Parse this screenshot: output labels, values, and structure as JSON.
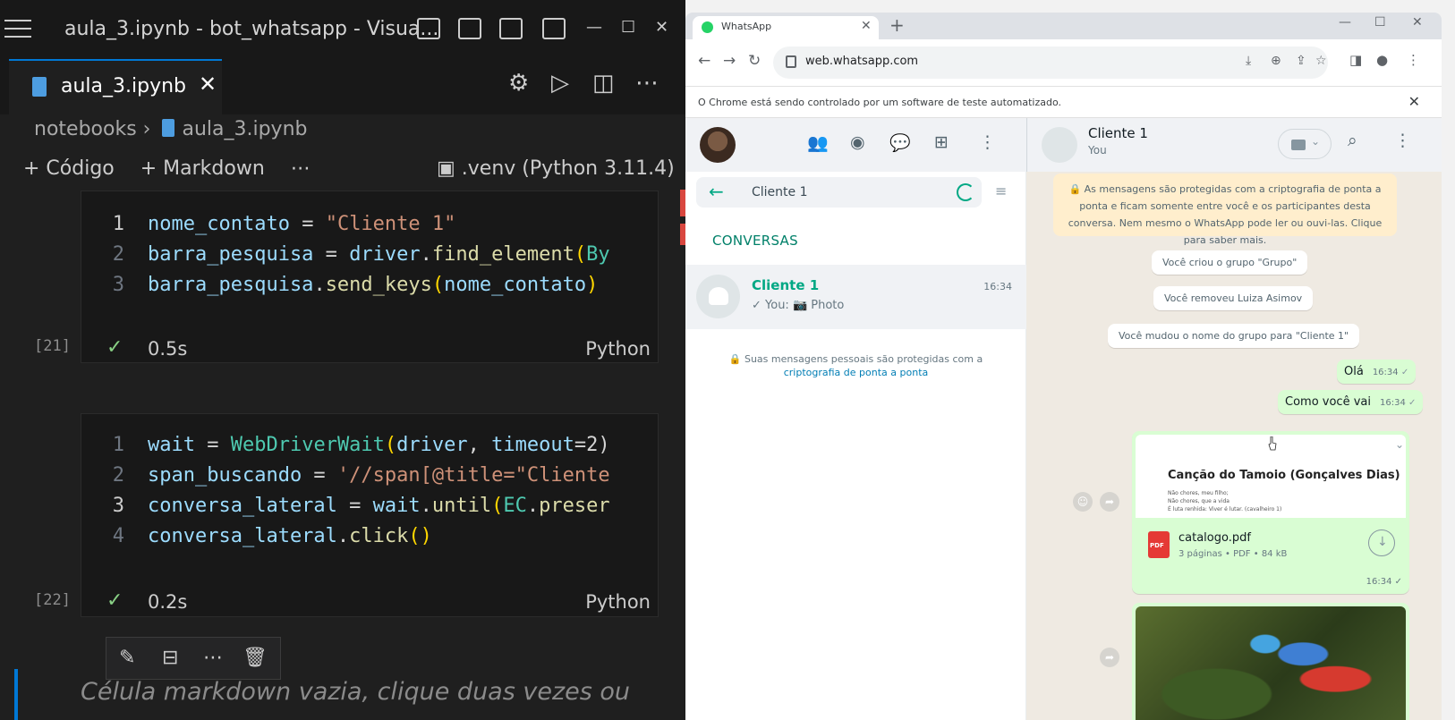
{
  "vscode": {
    "window_title": "aula_3.ipynb - bot_whatsapp - Visua...",
    "tab": {
      "label": "aula_3.ipynb",
      "close": "✕"
    },
    "window_controls": {
      "minimize": "—",
      "maximize": "☐",
      "close": "✕"
    },
    "editor_actions": {
      "settings": "⚙",
      "run": "▷",
      "split": "◫",
      "more": "⋯"
    },
    "breadcrumb": {
      "folder": "notebooks",
      "separator": "›",
      "file": "aula_3.ipynb"
    },
    "toolbar": {
      "add_code": "+ Código",
      "add_markdown": "+ Markdown",
      "more": "⋯"
    },
    "kernel": "▣ .venv (Python 3.11.4)",
    "cells": [
      {
        "exec_count": "[21]",
        "status_icon": "✓",
        "duration": "0.5s",
        "language": "Python",
        "lines": [
          {
            "number": "1",
            "tokens": [
              [
                "v",
                "nome_contato"
              ],
              [
                "o",
                " = "
              ],
              [
                "s",
                "\"Cliente 1\""
              ]
            ]
          },
          {
            "number": "2",
            "tokens": [
              [
                "v",
                "barra_pesquisa"
              ],
              [
                "o",
                " = "
              ],
              [
                "v",
                "driver"
              ],
              [
                "o",
                "."
              ],
              [
                "f",
                "find_element"
              ],
              [
                "p",
                "("
              ],
              [
                "c",
                "By"
              ]
            ]
          },
          {
            "number": "3",
            "tokens": [
              [
                "v",
                "barra_pesquisa"
              ],
              [
                "o",
                "."
              ],
              [
                "f",
                "send_keys"
              ],
              [
                "p",
                "("
              ],
              [
                "v",
                "nome_contato"
              ],
              [
                "p",
                ")"
              ]
            ]
          }
        ]
      },
      {
        "exec_count": "[22]",
        "status_icon": "✓",
        "duration": "0.2s",
        "language": "Python",
        "lines": [
          {
            "number": "1",
            "tokens": [
              [
                "v",
                "wait"
              ],
              [
                "o",
                " = "
              ],
              [
                "c",
                "WebDriverWait"
              ],
              [
                "p",
                "("
              ],
              [
                "v",
                "driver"
              ],
              [
                "o",
                ", "
              ],
              [
                "v",
                "timeout"
              ],
              [
                "o",
                "=2)"
              ]
            ]
          },
          {
            "number": "2",
            "tokens": [
              [
                "v",
                "span_buscando"
              ],
              [
                "o",
                " = "
              ],
              [
                "s",
                "'//span[@title=\"Cliente"
              ]
            ]
          },
          {
            "number": "3",
            "tokens": [
              [
                "v",
                "conversa_lateral"
              ],
              [
                "o",
                " = "
              ],
              [
                "v",
                "wait"
              ],
              [
                "o",
                "."
              ],
              [
                "f",
                "until"
              ],
              [
                "p",
                "("
              ],
              [
                "c",
                "EC"
              ],
              [
                "o",
                "."
              ],
              [
                "f",
                "preser"
              ]
            ]
          },
          {
            "number": "4",
            "tokens": [
              [
                "v",
                "conversa_lateral"
              ],
              [
                "o",
                "."
              ],
              [
                "f",
                "click"
              ],
              [
                "p",
                "()"
              ]
            ]
          }
        ]
      }
    ],
    "cell_tools": {
      "edit": "✎",
      "split": "⊟",
      "more": "⋯",
      "delete": "🗑"
    },
    "markdown_placeholder": "Célula markdown vazia, clique duas vezes ou"
  },
  "chrome": {
    "tab_title": "WhatsApp",
    "tab_close": "✕",
    "new_tab": "+",
    "window_controls": {
      "minimize": "—",
      "maximize": "☐",
      "close": "✕"
    },
    "nav": {
      "back": "←",
      "forward": "→",
      "reload": "↻"
    },
    "url": "web.whatsapp.com",
    "infobar": "O Chrome está sendo controlado por um software de teste automatizado.",
    "infobar_close": "✕"
  },
  "whatsapp": {
    "left_header_icons": {
      "communities": "👥",
      "status": "◉",
      "channels": "💬",
      "new_chat": "⊞",
      "menu": "⋮"
    },
    "search": {
      "back": "←",
      "value": "Cliente 1"
    },
    "filter_icon": "≡",
    "section_title": "CONVERSAS",
    "chat": {
      "name": "Cliente 1",
      "time": "16:34",
      "preview": "✓ You: 📷 Photo"
    },
    "encryption_note": "Suas mensagens pessoais são protegidas com a",
    "encryption_link": "criptografia de ponta a ponta",
    "header": {
      "name": "Cliente 1",
      "subtitle": "You",
      "video_caret": "⌄",
      "search": "⌕",
      "menu": "⋮"
    },
    "crypto_notice": "🔒 As mensagens são protegidas com a criptografia de ponta a ponta e ficam somente entre você e os participantes desta conversa. Nem mesmo o WhatsApp pode ler ou ouvi-las. Clique para saber mais.",
    "system_messages": [
      "Você criou o grupo \"Grupo\"",
      "Você removeu Luiza Asimov",
      "Você mudou o nome do grupo para \"Cliente 1\""
    ],
    "messages": [
      {
        "text": "Olá",
        "time": "16:34",
        "tick": "✓"
      },
      {
        "text": "Como você vai",
        "time": "16:34",
        "tick": "✓"
      }
    ],
    "document": {
      "preview_title": "Canção do Tamoio (Gonçalves Dias)",
      "preview_lines": [
        "Não chores, meu filho;",
        "Não chores, que a vida",
        "É luta renhida: Viver é lutar.            (cavalheiro 1)"
      ],
      "caret": "⌄",
      "type_badge": "PDF",
      "filename": "catalogo.pdf",
      "meta": "3 páginas • PDF • 84 kB",
      "download": "↓",
      "time": "16:34 ✓"
    },
    "reactions": {
      "emoji": "☺",
      "forward": "➦"
    }
  }
}
